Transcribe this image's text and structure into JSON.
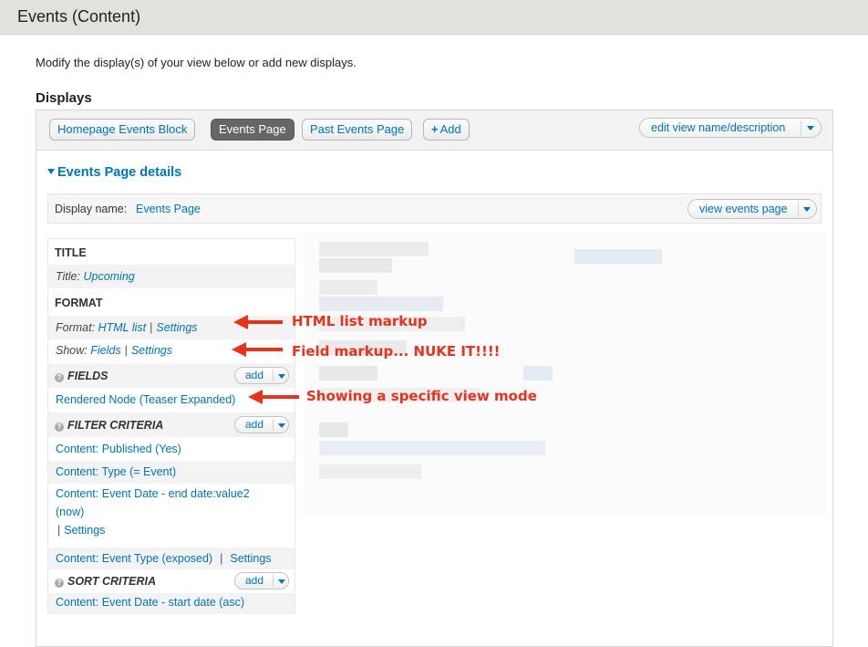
{
  "page": {
    "title": "Events (Content)",
    "intro": "Modify the display(s) of your view below or add new displays."
  },
  "displays": {
    "heading": "Displays",
    "tabs": [
      {
        "label": "Homepage Events Block",
        "active": false
      },
      {
        "label": "Events Page",
        "active": true
      },
      {
        "label": "Past Events Page",
        "active": false
      }
    ],
    "add_label": "Add",
    "edit_view_label": "edit view name/description"
  },
  "details": {
    "toggle_label": "Events Page details",
    "display_name_label": "Display name:",
    "display_name_value": "Events Page",
    "view_page_label": "view events page"
  },
  "left": {
    "title_section": "TITLE",
    "title_label": "Title:",
    "title_value": "Upcoming",
    "format_section": "FORMAT",
    "format_label": "Format:",
    "format_value": "HTML list",
    "format_settings": "Settings",
    "show_label": "Show:",
    "show_value": "Fields",
    "show_settings": "Settings",
    "fields_section": "FIELDS",
    "fields_add": "add",
    "fields_item": "Rendered Node (Teaser Expanded)",
    "filter_section": "FILTER CRITERIA",
    "filter_add": "add",
    "filter_items": [
      "Content: Published (Yes)",
      "Content: Type (= Event)",
      "Content: Event Date - end date:value2",
      "(now)"
    ],
    "filter_sep": "|",
    "filter_settings": "Settings",
    "filter_item5": "Content: Event Type (exposed)",
    "filter_item5_settings": "Settings",
    "sort_section": "SORT CRITERIA",
    "sort_add": "add",
    "sort_item": "Content: Event Date - start date (asc)",
    "pipe": "|"
  },
  "annotations": {
    "a1": "HTML list markup",
    "a2": "Field markup... NUKE IT!!!!",
    "a3": "Showing a specific view mode"
  },
  "colors": {
    "link": "#0074bd",
    "annotation": "#e8321c",
    "active_tab": "#666666"
  }
}
